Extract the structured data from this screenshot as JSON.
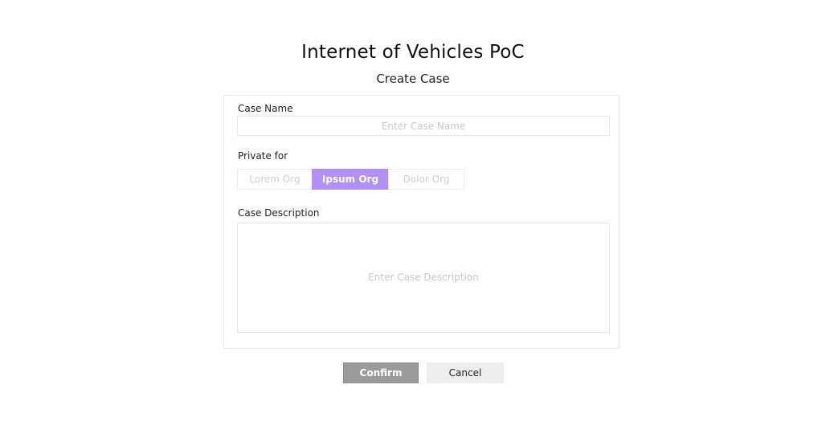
{
  "header": {
    "app_title": "Internet of Vehicles PoC",
    "subtitle": "Create Case"
  },
  "form": {
    "case_name": {
      "label": "Case Name",
      "placeholder": "Enter Case Name",
      "value": ""
    },
    "private_for": {
      "label": "Private for",
      "options": [
        {
          "label": "Lorem Org",
          "selected": false
        },
        {
          "label": "Ipsum Org",
          "selected": true
        },
        {
          "label": "Dolor Org",
          "selected": false
        }
      ],
      "selected_value": "Ipsum Org"
    },
    "case_description": {
      "label": "Case Description",
      "placeholder": "Enter Case Description",
      "value": ""
    }
  },
  "actions": {
    "confirm_label": "Confirm",
    "cancel_label": "Cancel"
  },
  "colors": {
    "selected_option_bg": "#b190f7",
    "confirm_bg": "#9b9b9b",
    "cancel_bg": "#eeeeee"
  }
}
